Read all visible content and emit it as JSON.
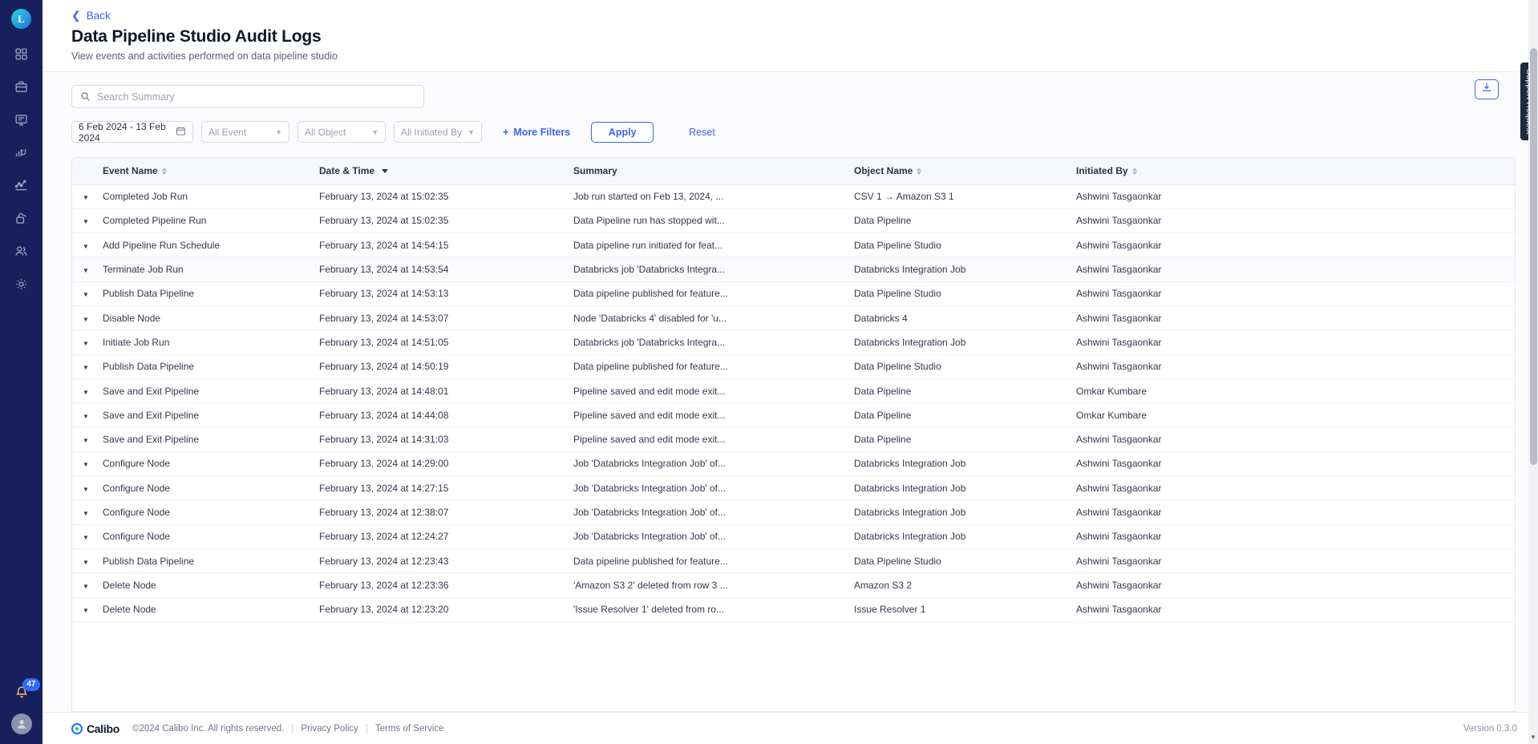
{
  "rail": {
    "logo_letter": "L",
    "items": [
      {
        "name": "dashboard-grid",
        "label": "Dashboard"
      },
      {
        "name": "briefcase",
        "label": "Projects"
      },
      {
        "name": "monitor-message",
        "label": "Collaboration"
      },
      {
        "name": "data-flow",
        "label": "Data"
      },
      {
        "name": "analytics-line",
        "label": "Analytics"
      },
      {
        "name": "unlock",
        "label": "Access"
      },
      {
        "name": "users",
        "label": "Users"
      },
      {
        "name": "gear",
        "label": "Settings"
      }
    ],
    "notification_count": "47"
  },
  "header": {
    "back_label": "Back",
    "title": "Data Pipeline Studio Audit Logs",
    "subtitle": "View events and activities performed on data pipeline studio"
  },
  "filters": {
    "search_placeholder": "Search Summary",
    "search_value": "",
    "date_range": "6 Feb 2024 - 13 Feb 2024",
    "event_select": "All Event",
    "object_select": "All Object",
    "initiated_select": "All Initiated By",
    "more_filters_label": "More Filters",
    "more_filters_plus": "+",
    "apply_label": "Apply",
    "reset_label": "Reset",
    "download_icon": "download-icon"
  },
  "table": {
    "columns": [
      {
        "key": "event_name",
        "label": "Event Name",
        "sort": "both"
      },
      {
        "key": "date_time",
        "label": "Date & Time",
        "sort": "desc"
      },
      {
        "key": "summary",
        "label": "Summary",
        "sort": "none"
      },
      {
        "key": "object_name",
        "label": "Object Name",
        "sort": "both"
      },
      {
        "key": "initiated_by",
        "label": "Initiated By",
        "sort": "both"
      }
    ],
    "rows": [
      {
        "event_name": "Completed Job Run",
        "date_time": "February 13, 2024 at 15:02:35",
        "summary": "Job run started on Feb 13, 2024, ...",
        "object_name": "CSV 1 → Amazon S3 1",
        "initiated_by": "Ashwini Tasgaonkar"
      },
      {
        "event_name": "Completed Pipeline Run",
        "date_time": "February 13, 2024 at 15:02:35",
        "summary": "Data Pipeline run has stopped wit...",
        "object_name": "Data Pipeline",
        "initiated_by": "Ashwini Tasgaonkar"
      },
      {
        "event_name": "Add Pipeline Run Schedule",
        "date_time": "February 13, 2024 at 14:54:15",
        "summary": "Data pipeline run initiated for feat...",
        "object_name": "Data Pipeline Studio",
        "initiated_by": "Ashwini Tasgaonkar"
      },
      {
        "event_name": "Terminate Job Run",
        "date_time": "February 13, 2024 at 14:53:54",
        "summary": "Databricks job 'Databricks Integra...",
        "object_name": "Databricks Integration Job",
        "initiated_by": "Ashwini Tasgaonkar"
      },
      {
        "event_name": "Publish Data Pipeline",
        "date_time": "February 13, 2024 at 14:53:13",
        "summary": "Data pipeline published for feature...",
        "object_name": "Data Pipeline Studio",
        "initiated_by": "Ashwini Tasgaonkar"
      },
      {
        "event_name": "Disable Node",
        "date_time": "February 13, 2024 at 14:53:07",
        "summary": "Node 'Databricks 4' disabled for 'u...",
        "object_name": "Databricks 4",
        "initiated_by": "Ashwini Tasgaonkar"
      },
      {
        "event_name": "Initiate Job Run",
        "date_time": "February 13, 2024 at 14:51:05",
        "summary": "Databricks job 'Databricks Integra...",
        "object_name": "Databricks Integration Job",
        "initiated_by": "Ashwini Tasgaonkar"
      },
      {
        "event_name": "Publish Data Pipeline",
        "date_time": "February 13, 2024 at 14:50:19",
        "summary": "Data pipeline published for feature...",
        "object_name": "Data Pipeline Studio",
        "initiated_by": "Ashwini Tasgaonkar"
      },
      {
        "event_name": "Save and Exit Pipeline",
        "date_time": "February 13, 2024 at 14:48:01",
        "summary": "Pipeline saved and edit mode exit...",
        "object_name": "Data Pipeline",
        "initiated_by": "Omkar Kumbare"
      },
      {
        "event_name": "Save and Exit Pipeline",
        "date_time": "February 13, 2024 at 14:44:08",
        "summary": "Pipeline saved and edit mode exit...",
        "object_name": "Data Pipeline",
        "initiated_by": "Omkar Kumbare"
      },
      {
        "event_name": "Save and Exit Pipeline",
        "date_time": "February 13, 2024 at 14:31:03",
        "summary": "Pipeline saved and edit mode exit...",
        "object_name": "Data Pipeline",
        "initiated_by": "Ashwini Tasgaonkar"
      },
      {
        "event_name": "Configure Node",
        "date_time": "February 13, 2024 at 14:29:00",
        "summary": "Job 'Databricks Integration Job' of...",
        "object_name": "Databricks Integration Job",
        "initiated_by": "Ashwini Tasgaonkar"
      },
      {
        "event_name": "Configure Node",
        "date_time": "February 13, 2024 at 14:27:15",
        "summary": "Job 'Databricks Integration Job' of...",
        "object_name": "Databricks Integration Job",
        "initiated_by": "Ashwini Tasgaonkar"
      },
      {
        "event_name": "Configure Node",
        "date_time": "February 13, 2024 at 12:38:07",
        "summary": "Job 'Databricks Integration Job' of...",
        "object_name": "Databricks Integration Job",
        "initiated_by": "Ashwini Tasgaonkar"
      },
      {
        "event_name": "Configure Node",
        "date_time": "February 13, 2024 at 12:24:27",
        "summary": "Job 'Databricks Integration Job' of...",
        "object_name": "Databricks Integration Job",
        "initiated_by": "Ashwini Tasgaonkar"
      },
      {
        "event_name": "Publish Data Pipeline",
        "date_time": "February 13, 2024 at 12:23:43",
        "summary": "Data pipeline published for feature...",
        "object_name": "Data Pipeline Studio",
        "initiated_by": "Ashwini Tasgaonkar"
      },
      {
        "event_name": "Delete Node",
        "date_time": "February 13, 2024 at 12:23:36",
        "summary": "'Amazon S3 2' deleted from row 3 ...",
        "object_name": "Amazon S3 2",
        "initiated_by": "Ashwini Tasgaonkar"
      },
      {
        "event_name": "Delete Node",
        "date_time": "February 13, 2024 at 12:23:20",
        "summary": "'Issue Resolver 1' deleted from ro...",
        "object_name": "Issue Resolver 1",
        "initiated_by": "Ashwini Tasgaonkar"
      }
    ]
  },
  "footer": {
    "brand": "Calibo",
    "copyright": "©2024 Calibo Inc. All rights reserved.",
    "privacy_label": "Privacy Policy",
    "terms_label": "Terms of Service",
    "separator": "|",
    "version": "Version 0.3.0"
  },
  "support_tab": {
    "label": "Support Request"
  }
}
